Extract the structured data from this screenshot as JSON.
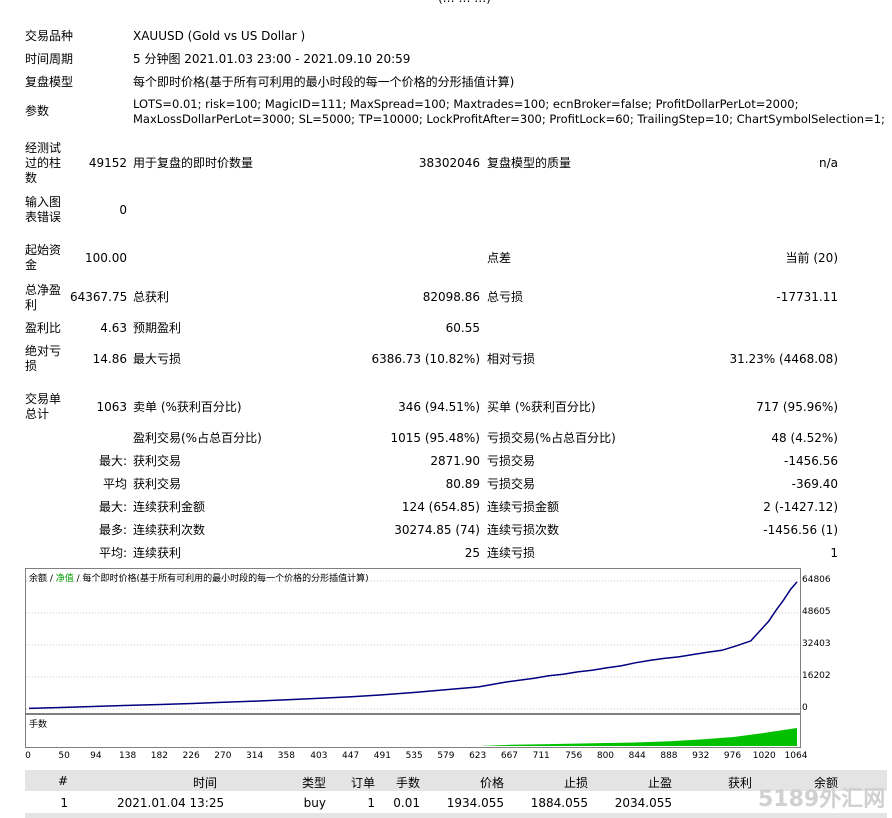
{
  "top_fragment": "(… … …)",
  "info": {
    "symbol_label": "交易品种",
    "symbol": "XAUUSD (Gold vs US Dollar )",
    "period_label": "时间周期",
    "period": "5 分钟图 2021.01.03 23:00 - 2021.09.10 20:59",
    "model_label": "复盘模型",
    "model": "每个即时价格(基于所有可利用的最小时段的每一个价格的分形插值计算)",
    "params_label": "参数",
    "params_line1": "LOTS=0.01; risk=100; MagicID=111; MaxSpread=100; Maxtrades=100; ecnBroker=false; ProfitDollarPerLot=2000;",
    "params_line2": "MaxLossDollarPerLot=3000; SL=5000; TP=10000; LockProfitAfter=300; ProfitLock=60; TrailingStep=10; ChartSymbolSelection=1;"
  },
  "stats": {
    "bars_label": "经测试过的柱数",
    "bars": "49152",
    "ticks_label": "用于复盘的即时价数量",
    "ticks": "38302046",
    "quality_label": "复盘模型的质量",
    "quality": "n/a",
    "errors_label": "输入图表错误",
    "errors": "0",
    "deposit_label": "起始资金",
    "deposit": "100.00",
    "spread_label": "点差",
    "spread": "当前 (20)",
    "net_label": "总净盈利",
    "net": "64367.75",
    "gross_profit_label": "总获利",
    "gross_profit": "82098.86",
    "gross_loss_label": "总亏损",
    "gross_loss": "-17731.11",
    "pf_label": "盈利比",
    "pf": "4.63",
    "payoff_label": "预期盈利",
    "payoff": "60.55",
    "abs_dd_label": "绝对亏损",
    "abs_dd": "14.86",
    "max_dd_label": "最大亏损",
    "max_dd": "6386.73 (10.82%)",
    "rel_dd_label": "相对亏损",
    "rel_dd": "31.23% (4468.08)",
    "trades_label": "交易单总计",
    "trades": "1063",
    "short_label": "卖单 (%获利百分比)",
    "short": "346 (94.51%)",
    "long_label": "买单 (%获利百分比)",
    "long": "717 (95.96%)",
    "profit_trades_label": "盈利交易(%占总百分比)",
    "profit_trades": "1015 (95.48%)",
    "loss_trades_label": "亏损交易(%占总百分比)",
    "loss_trades": "48 (4.52%)",
    "largest_prefix": "最大:",
    "largest_profit_label": "获利交易",
    "largest_profit": "2871.90",
    "largest_loss_label": "亏损交易",
    "largest_loss": "-1456.56",
    "average_prefix": "平均",
    "avg_profit_label": "获利交易",
    "avg_profit": "80.89",
    "avg_loss_label": "亏损交易",
    "avg_loss": "-369.40",
    "max_prefix": "最大:",
    "max_consec_wins_label": "连续获利金额",
    "max_consec_wins": "124 (654.85)",
    "max_consec_losses_label": "连续亏损金额",
    "max_consec_losses": "2 (-1427.12)",
    "most_prefix": "最多:",
    "max_consec_profit_label": "连续获利次数",
    "max_consec_profit": "30274.85 (74)",
    "max_consec_loss_label": "连续亏损次数",
    "max_consec_loss": "-1456.56 (1)",
    "avg_prefix": "平均:",
    "avg_consec_wins_label": "连续获利",
    "avg_consec_wins": "25",
    "avg_consec_losses_label": "连续亏损",
    "avg_consec_losses": "1"
  },
  "chart_title": {
    "balance": "余额",
    "sep1": " / ",
    "equity": "净值",
    "rest": " / 每个即时价格(基于所有可利用的最小时段的每一个价格的分形插值计算)"
  },
  "lots_label": "手数",
  "chart_data": {
    "type": "line",
    "yticks": [
      "64806",
      "48605",
      "32403",
      "16202",
      "0"
    ],
    "ylim": [
      0,
      64806
    ],
    "xticks": [
      "0",
      "50",
      "94",
      "138",
      "182",
      "226",
      "270",
      "314",
      "358",
      "403",
      "447",
      "491",
      "535",
      "579",
      "623",
      "667",
      "711",
      "756",
      "800",
      "844",
      "888",
      "932",
      "976",
      "1020",
      "1064"
    ],
    "xlim": [
      0,
      1064
    ],
    "colors": {
      "balance": "#000080",
      "lots": "#00c000"
    },
    "series": [
      {
        "name": "余额",
        "x": [
          0,
          50,
          94,
          138,
          182,
          226,
          270,
          314,
          358,
          403,
          447,
          491,
          535,
          579,
          623,
          660,
          700,
          720,
          740,
          760,
          780,
          800,
          820,
          840,
          860,
          880,
          900,
          920,
          940,
          960,
          980,
          1000,
          1015,
          1025,
          1035,
          1045,
          1055,
          1064
        ],
        "y": [
          300,
          800,
          1300,
          1800,
          2300,
          2800,
          3400,
          4000,
          4700,
          5400,
          6200,
          7200,
          8400,
          9800,
          11200,
          13600,
          15600,
          16800,
          17600,
          18800,
          19600,
          20800,
          21800,
          23400,
          24600,
          25600,
          26400,
          27600,
          28700,
          29700,
          32000,
          34500,
          40500,
          44500,
          50000,
          55000,
          60500,
          64367
        ]
      }
    ],
    "lots": {
      "x": [
        0,
        623,
        667,
        711,
        756,
        800,
        844,
        888,
        932,
        976,
        1020,
        1064
      ],
      "y": [
        0,
        0,
        0.002,
        0.003,
        0.004,
        0.005,
        0.006,
        0.008,
        0.011,
        0.015,
        0.022,
        0.03
      ]
    }
  },
  "table": {
    "headers": [
      "#",
      "时间",
      "类型",
      "订单",
      "手数",
      "价格",
      "止损",
      "止盈",
      "获利",
      "余额"
    ],
    "row": [
      "1",
      "2021.01.04 13:25",
      "buy",
      "1",
      "0.01",
      "1934.055",
      "1884.055",
      "2034.055",
      "",
      ""
    ]
  },
  "watermark": "5189外汇网"
}
